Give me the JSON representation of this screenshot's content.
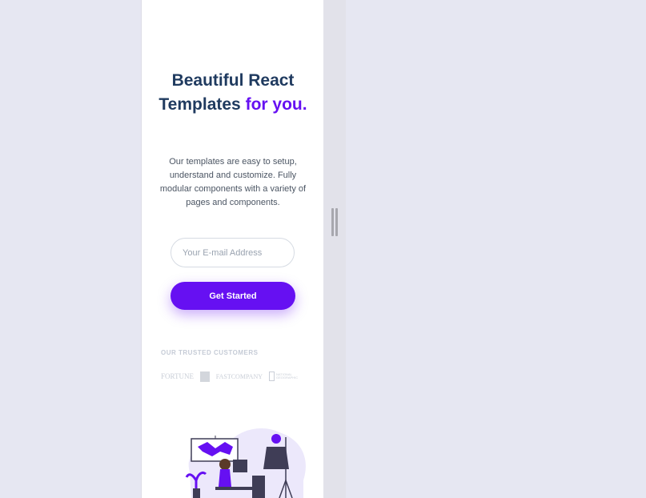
{
  "hero": {
    "headline_part1": "Beautiful React Templates",
    "headline_accent": "for you.",
    "description": "Our templates are easy to setup, understand and customize. Fully modular components with a variety of pages and components."
  },
  "form": {
    "email_placeholder": "Your E-mail Address",
    "cta_label": "Get Started"
  },
  "customers": {
    "title": "OUR TRUSTED CUSTOMERS",
    "logos": {
      "fortune": "FORTUNE",
      "fastcompany": "FASTCOMPANY",
      "natgeo": "NATIONAL GEOGRAPHIC"
    }
  },
  "colors": {
    "accent": "#6610f2",
    "heading": "#1f3a5f",
    "page_bg": "#e6e7f2"
  }
}
